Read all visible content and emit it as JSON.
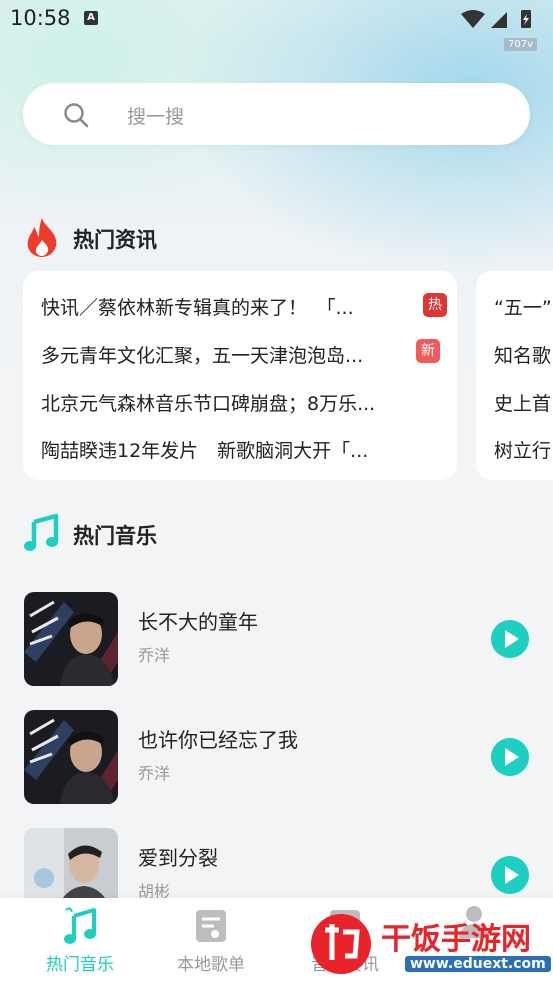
{
  "status_bar": {
    "time": "10:58",
    "notification_badge": "A",
    "net_speed": "707v"
  },
  "search": {
    "placeholder": "搜一搜"
  },
  "hot_news": {
    "title": "热门资讯",
    "cards": [
      {
        "items": [
          {
            "text": "快讯／蔡依林新专辑真的来了！　「...",
            "badge": "热",
            "badge_color": "#e03535"
          },
          {
            "text": "多元青年文化汇聚，五一天津泡泡岛...",
            "badge": "新",
            "badge_color": "#f05a5a"
          },
          {
            "text": "北京元气森林音乐节口碑崩盘；8万乐...",
            "badge": null
          },
          {
            "text": "陶喆睽违12年发片　新歌脑洞大开「...",
            "badge": null
          }
        ]
      },
      {
        "items": [
          {
            "text": "“五一”"
          },
          {
            "text": "知名歌"
          },
          {
            "text": "史上首"
          },
          {
            "text": "树立行"
          }
        ]
      }
    ]
  },
  "hot_music": {
    "title": "热门音乐",
    "songs": [
      {
        "title": "长不大的童年",
        "artist": "乔洋"
      },
      {
        "title": "也许你已经忘了我",
        "artist": "乔洋"
      },
      {
        "title": "爱到分裂",
        "artist": "胡彬"
      }
    ]
  },
  "tabs": [
    {
      "label": "热门音乐",
      "active": true,
      "icon": "music-note-icon"
    },
    {
      "label": "本地歌单",
      "active": false,
      "icon": "playlist-icon"
    },
    {
      "label": "音乐资讯",
      "active": false,
      "icon": "news-icon"
    },
    {
      "label": "我的",
      "active": false,
      "icon": "person-icon"
    }
  ],
  "watermark": {
    "brand": "干饭手游网",
    "url": "www.eduext.com"
  },
  "colors": {
    "accent": "#1ccfc0",
    "hot_badge": "#e03535",
    "new_badge": "#f05a5a",
    "flame": "#ef3a2c"
  }
}
